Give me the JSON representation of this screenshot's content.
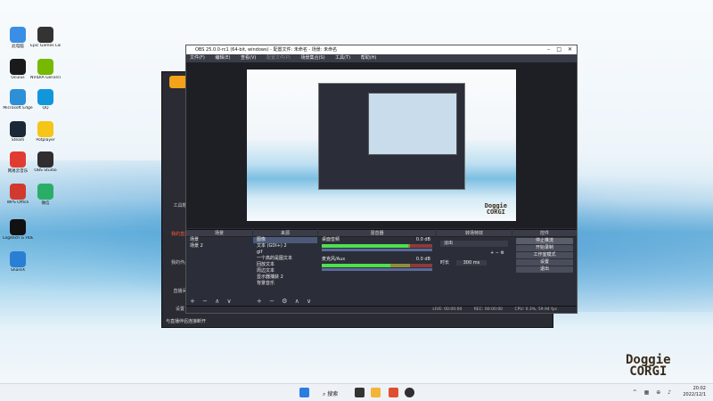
{
  "desktop": {
    "icons": [
      {
        "label": "此电脑",
        "color": "#3a8ee6"
      },
      {
        "label": "Oculus",
        "color": "#1a1a1a"
      },
      {
        "label": "Microsoft Edge",
        "color": "#2d8fd6"
      },
      {
        "label": "Steam",
        "color": "#1b2838"
      },
      {
        "label": "网易云音乐",
        "color": "#e03c31"
      },
      {
        "label": "WPS Office",
        "color": "#d23a2f"
      },
      {
        "label": "Logitech G HUB",
        "color": "#111111"
      },
      {
        "label": "ShareX",
        "color": "#2a7fd4"
      },
      {
        "label": "Epic Games Launcher",
        "color": "#333333"
      },
      {
        "label": "NVIDIA GeForce Experience",
        "color": "#76b900"
      },
      {
        "label": "QQ",
        "color": "#1296db"
      },
      {
        "label": "Potplayer",
        "color": "#f5c518"
      },
      {
        "label": "OBS Studio",
        "color": "#302e31"
      },
      {
        "label": "微信",
        "color": "#2aae67"
      }
    ],
    "watermark_line1": "Doggie",
    "watermark_line2": "CORGI"
  },
  "bg_app": {
    "sidebar": [
      "工具箱",
      "我的直播",
      "我的作品",
      "直播间",
      "设置"
    ],
    "status_text": "与直播伴侣连接断开"
  },
  "obs": {
    "title": "OBS 25.0.0-rc1 (64-bit, windows) - 配置文件: 未命名 - 场景: 未命名",
    "menu": [
      "文件(F)",
      "编辑(E)",
      "查看(V)",
      "配置文件(P)",
      "场景集合(S)",
      "工具(T)",
      "帮助(H)"
    ],
    "docks": {
      "scenes": {
        "header": "场景",
        "items": [
          "场景",
          "场景 2"
        ]
      },
      "sources": {
        "header": "来源",
        "items": [
          "图像",
          "文本 (GDI+) 2",
          "gif",
          "一个高的是图文本",
          "回放文本",
          "周边文本",
          "显示器捕获 2",
          "背景音乐"
        ]
      },
      "mixer": {
        "header": "混音器",
        "tracks": [
          {
            "name": "桌面音频",
            "db": "0.0 dB",
            "level": 0.78
          },
          {
            "name": "麦克风/Aux",
            "db": "0.0 dB",
            "level": 0.62
          }
        ]
      },
      "transitions": {
        "header": "转场特效",
        "type": "淡出",
        "duration_label": "时长",
        "duration": "300 ms"
      },
      "controls": {
        "header": "控件",
        "buttons": [
          "停止推流",
          "开始录制",
          "工作室模式",
          "设置",
          "退出"
        ]
      }
    },
    "status": {
      "live": "LIVE: 00:00:00",
      "rec": "REC: 00:00:00",
      "cpu": "CPU: 0.3%, 59.94 fps"
    }
  },
  "taskbar": {
    "search_placeholder": "搜索",
    "time": "20:02",
    "date": "2022/12/1"
  }
}
